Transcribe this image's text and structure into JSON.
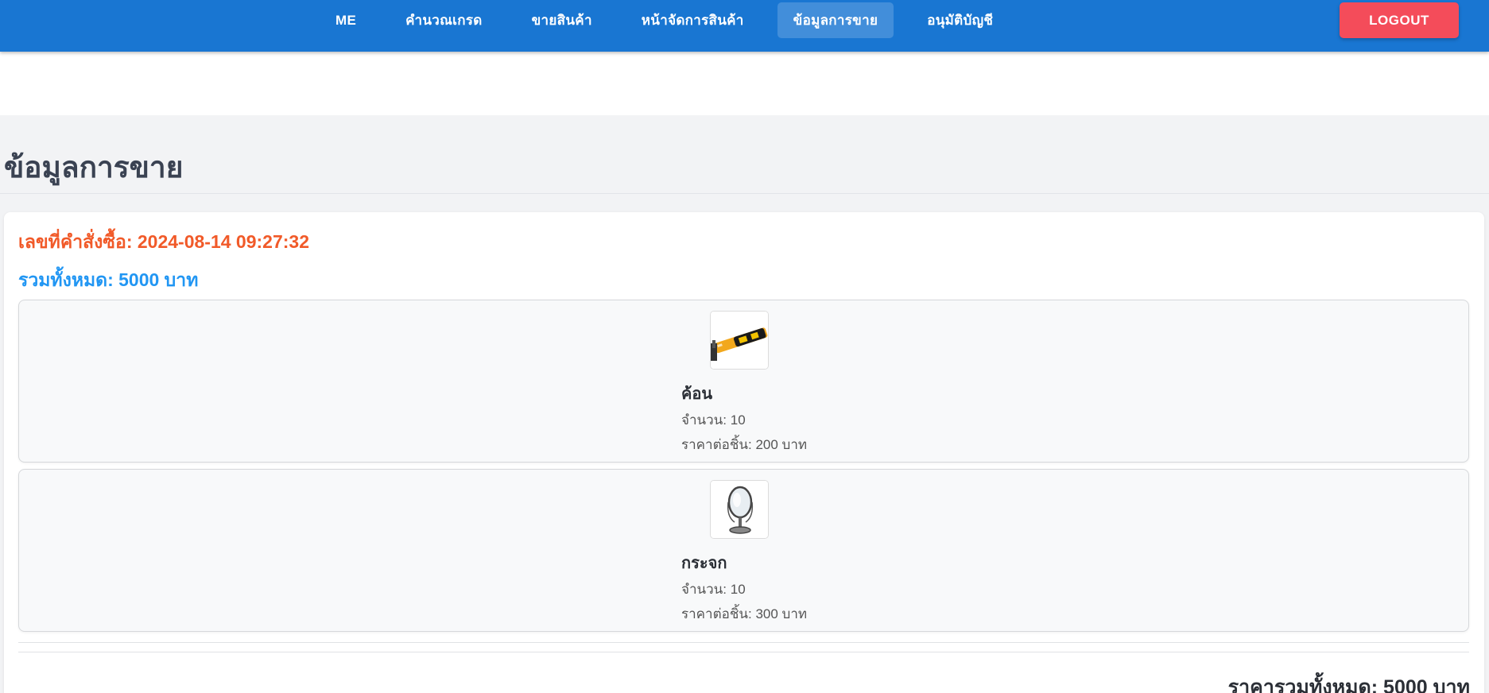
{
  "nav": {
    "items": [
      {
        "label": "ME"
      },
      {
        "label": "คำนวณเกรด"
      },
      {
        "label": "ขายสินค้า"
      },
      {
        "label": "หน้าจัดการสินค้า"
      },
      {
        "label": "ข้อมูลการขาย"
      },
      {
        "label": "อนุมัติบัญชี"
      }
    ],
    "active": "ข้อมูลการขาย",
    "logout_label": "LOGOUT"
  },
  "page": {
    "title": "ข้อมูลการขาย"
  },
  "order": {
    "id_text": "เลขที่คำสั่งซื้อ: 2024-08-14 09:27:32",
    "total_text": "รวมทั้งหมด: 5000 บาท",
    "items": [
      {
        "name": "ค้อน",
        "qty_text": "จำนวน: 10",
        "price_text": "ราคาต่อชิ้น: 200 บาท",
        "image": "hammer-image"
      },
      {
        "name": "กระจก",
        "qty_text": "จำนวน: 10",
        "price_text": "ราคาต่อชิ้น: 300 บาท",
        "image": "mirror-image"
      }
    ],
    "grand_total_text": "ราคารวมทั้งหมด: 5000 บาท"
  },
  "colors": {
    "navbar": "#1976d2",
    "logout": "#f44c5a",
    "order_id": "#f15a29",
    "order_total": "#2196f3",
    "content_bg": "#f2f3f5"
  }
}
